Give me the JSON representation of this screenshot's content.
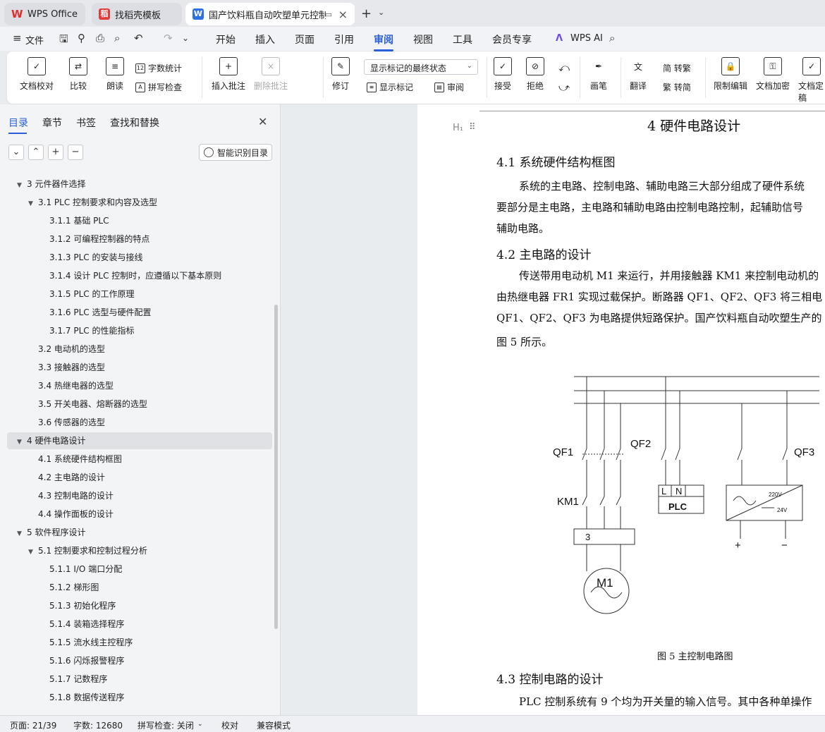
{
  "tabs": [
    {
      "label": "WPS Office",
      "icon": "wps-logo-icon"
    },
    {
      "label": "找稻壳模板",
      "icon": "docer-logo-icon"
    },
    {
      "label": "国产饮料瓶自动吹塑单元控制系统设计",
      "icon": "writer-doc-icon",
      "active": true
    }
  ],
  "menu": {
    "file": "文件",
    "items": [
      "开始",
      "插入",
      "页面",
      "引用",
      "审阅",
      "视图",
      "工具",
      "会员专享"
    ],
    "active": "审阅",
    "ai": "WPS AI"
  },
  "ribbon": {
    "doc_check": "文档校对",
    "compare": "比较",
    "read_aloud": "朗读",
    "word_count": "字数统计",
    "spell_check": "拼写检查",
    "insert_comment": "插入批注",
    "delete_comment": "删除批注",
    "revise": "修订",
    "markup_state": "显示标记的最终状态",
    "show_markup": "显示标记",
    "review": "审阅",
    "accept": "接受",
    "reject": "拒绝",
    "pen": "画笔",
    "translate": "翻译",
    "to_traditional": "简 转繁",
    "to_simplified": "繁 转简",
    "restrict_edit": "限制编辑",
    "encrypt": "文档加密",
    "doc_final": "文档定稿"
  },
  "sidebar": {
    "tabs": [
      "目录",
      "章节",
      "书签",
      "查找和替换"
    ],
    "active_tab": "目录",
    "smart_toc": "智能识别目录",
    "toc": [
      {
        "label": "3 元件器件选择",
        "level": 0,
        "expanded": true
      },
      {
        "label": "3.1 PLC 控制要求和内容及选型",
        "level": 1,
        "expanded": true
      },
      {
        "label": "3.1.1 基础 PLC",
        "level": 2
      },
      {
        "label": "3.1.2 可编程控制器的特点",
        "level": 2
      },
      {
        "label": "3.1.3 PLC 的安装与接线",
        "level": 2
      },
      {
        "label": "3.1.4 设计 PLC 控制时，应遵循以下基本原则",
        "level": 2
      },
      {
        "label": "3.1.5 PLC 的工作原理",
        "level": 2
      },
      {
        "label": "3.1.6 PLC 选型与硬件配置",
        "level": 2
      },
      {
        "label": "3.1.7 PLC 的性能指标",
        "level": 2
      },
      {
        "label": "3.2 电动机的选型",
        "level": 1
      },
      {
        "label": "3.3 接触器的选型",
        "level": 1
      },
      {
        "label": "3.4 热继电器的选型",
        "level": 1
      },
      {
        "label": "3.5 开关电器、熔断器的选型",
        "level": 1
      },
      {
        "label": "3.6 传感器的选型",
        "level": 1
      },
      {
        "label": "4 硬件电路设计",
        "level": 0,
        "expanded": true,
        "selected": true
      },
      {
        "label": "4.1 系统硬件结构框图",
        "level": 1
      },
      {
        "label": "4.2 主电路的设计",
        "level": 1
      },
      {
        "label": "4.3 控制电路的设计",
        "level": 1
      },
      {
        "label": "4.4 操作面板的设计",
        "level": 1
      },
      {
        "label": "5 软件程序设计",
        "level": 0,
        "expanded": true
      },
      {
        "label": "5.1 控制要求和控制过程分析",
        "level": 1,
        "expanded": true
      },
      {
        "label": "5.1.1 I/O 端口分配",
        "level": 2
      },
      {
        "label": "5.1.2 梯形图",
        "level": 2
      },
      {
        "label": "5.1.3 初始化程序",
        "level": 2
      },
      {
        "label": "5.1.4 装箱选择程序",
        "level": 2
      },
      {
        "label": "5.1.5 流水线主控程序",
        "level": 2
      },
      {
        "label": "5.1.6 闪烁报警程序",
        "level": 2
      },
      {
        "label": "5.1.7 记数程序",
        "level": 2
      },
      {
        "label": "5.1.8 数据传送程序",
        "level": 2
      }
    ]
  },
  "document": {
    "chapter_title": "4  硬件电路设计",
    "s41_heading": "4.1 系统硬件结构框图",
    "s41_lines": [
      "系统的主电路、控制电路、辅助电路三大部分组成了硬件系统",
      "要部分是主电路，主电路和辅助电路由控制电路控制，起辅助信号",
      "辅助电路。"
    ],
    "s42_heading": "4.2 主电路的设计",
    "s42_lines": [
      "传送带用电动机 M1 来运行，并用接触器 KM1 来控制电动机的",
      "由热继电器 FR1 实现过载保护。断路器 QF1、QF2、QF3 将三相电",
      "QF1、QF2、QF3 为电路提供短路保护。国产饮料瓶自动吹塑生产的",
      "图 5 所示。"
    ],
    "figure": {
      "qf1": "QF1",
      "qf2": "QF2",
      "qf3": "QF3",
      "km1": "KM1",
      "m1": "M1",
      "relay_num": "3",
      "plc": "PLC",
      "l": "L",
      "n": "N",
      "v220": "220V",
      "v24": "24V",
      "plus": "+",
      "minus": "−"
    },
    "figure_caption": "图 5 主控制电路图",
    "s43_heading": "4.3 控制电路的设计",
    "s43_lines": [
      "PLC 控制系统有 9 个均为开关量的输入信号。其中各种单操作"
    ]
  },
  "status": {
    "page": "页面: 21/39",
    "words": "字数: 12680",
    "spell": "拼写检查: 关闭",
    "proof": "校对",
    "compat": "兼容模式"
  },
  "colors": {
    "accent": "#2b5fd9",
    "wps_red": "#e0302f"
  }
}
